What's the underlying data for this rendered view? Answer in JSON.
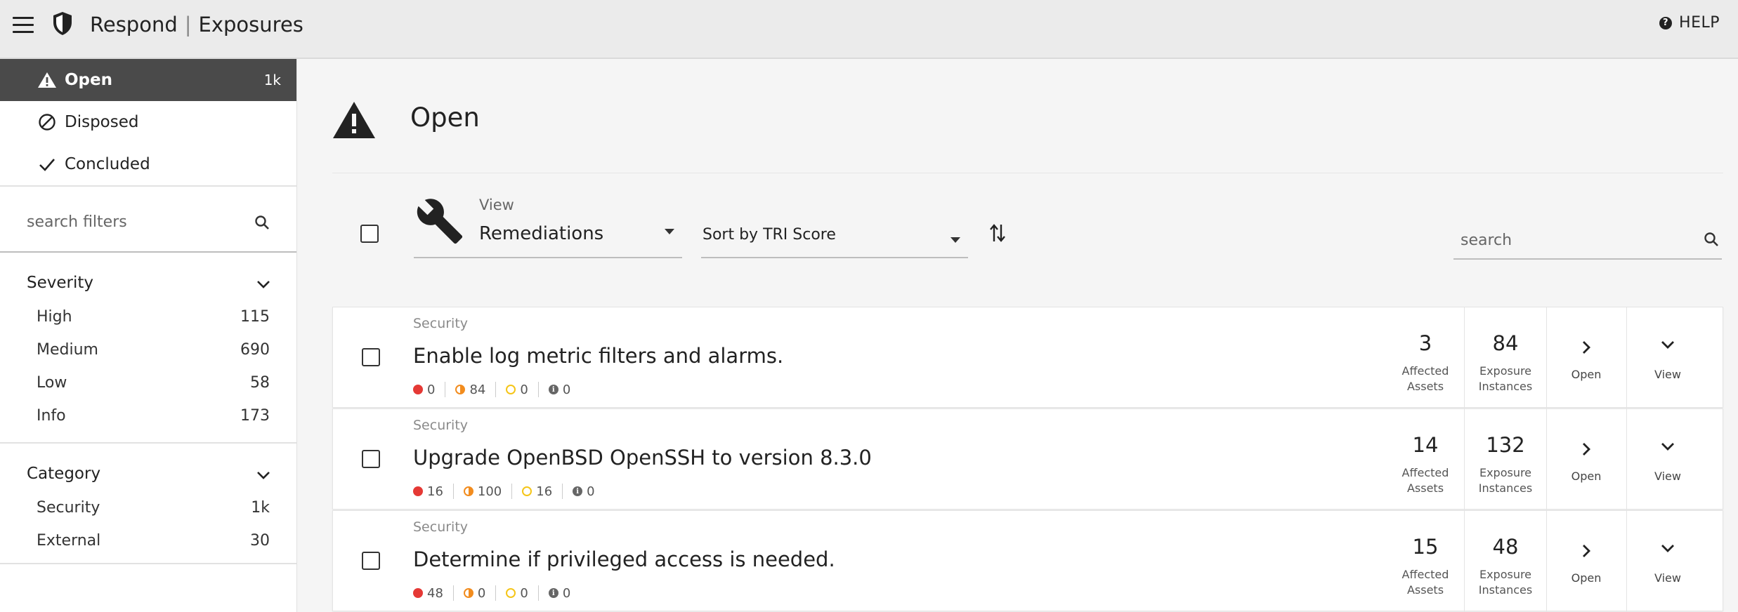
{
  "app": {
    "title_left": "Respond",
    "separator": "|",
    "title_right": "Exposures",
    "help_label": "HELP"
  },
  "sidebar": {
    "statuses": [
      {
        "label": "Open",
        "count": "1k",
        "icon": "warning-icon",
        "active": true
      },
      {
        "label": "Disposed",
        "count": "",
        "icon": "disposed-icon",
        "active": false
      },
      {
        "label": "Concluded",
        "count": "",
        "icon": "check-icon",
        "active": false
      }
    ],
    "search_placeholder": "search filters",
    "severity": {
      "label": "Severity",
      "items": [
        {
          "label": "High",
          "count": "115"
        },
        {
          "label": "Medium",
          "count": "690"
        },
        {
          "label": "Low",
          "count": "58"
        },
        {
          "label": "Info",
          "count": "173"
        }
      ]
    },
    "category": {
      "label": "Category",
      "items": [
        {
          "label": "Security",
          "count": "1k"
        },
        {
          "label": "External",
          "count": "30"
        }
      ]
    }
  },
  "page": {
    "title": "Open"
  },
  "toolbar": {
    "view_label": "View",
    "view_value": "Remediations",
    "sort_value": "Sort by TRI Score",
    "search_placeholder": "search"
  },
  "labels": {
    "affected_assets_1": "Affected",
    "affected_assets_2": "Assets",
    "exposure_instances_1": "Exposure",
    "exposure_instances_2": "Instances",
    "open": "Open",
    "view": "View"
  },
  "remediations": [
    {
      "category": "Security",
      "title": "Enable log metric filters and alarms.",
      "high": "0",
      "medium": "84",
      "low": "0",
      "info": "0",
      "affected_assets": "3",
      "exposure_instances": "84"
    },
    {
      "category": "Security",
      "title": "Upgrade OpenBSD OpenSSH to version 8.3.0",
      "high": "16",
      "medium": "100",
      "low": "16",
      "info": "0",
      "affected_assets": "14",
      "exposure_instances": "132"
    },
    {
      "category": "Security",
      "title": "Determine if privileged access is needed.",
      "high": "48",
      "medium": "0",
      "low": "0",
      "info": "0",
      "affected_assets": "15",
      "exposure_instances": "48"
    }
  ]
}
